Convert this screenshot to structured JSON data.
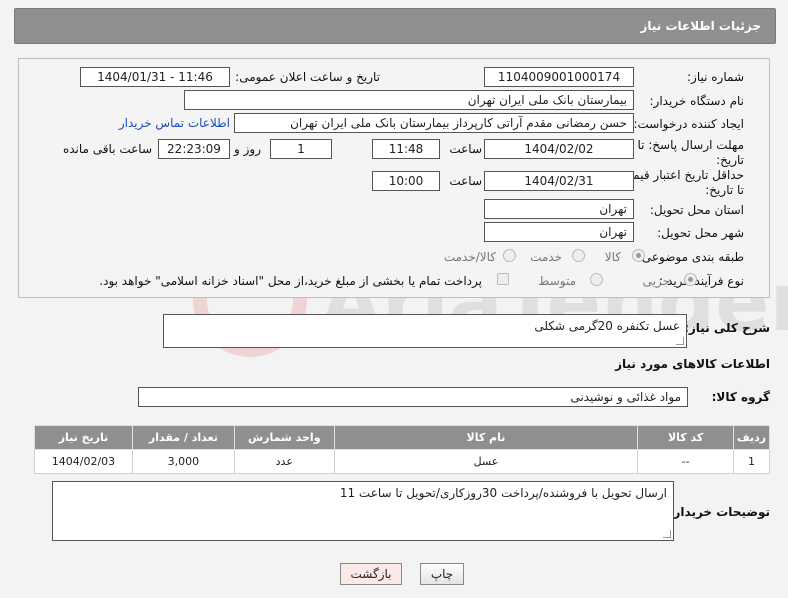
{
  "header": {
    "title": "جزئیات اطلاعات نیاز"
  },
  "form": {
    "need_number_label": "شماره نیاز:",
    "need_number": "1104009001000174",
    "announce_label": "تاریخ و ساعت اعلان عمومی:",
    "announce_value": "1404/01/31 - 11:46",
    "buyer_org_label": "نام دستگاه خریدار:",
    "buyer_org": "بیمارستان بانک ملی ایران تهران",
    "creator_label": "ایجاد کننده درخواست:",
    "creator": "حسن رمضانی مقدم آراتی کارپرداز بیمارستان بانک ملی ایران تهران",
    "contact_link": "اطلاعات تماس خریدار",
    "deadline_label": "مهلت ارسال پاسخ: تا تاریخ:",
    "deadline_date": "1404/02/02",
    "time_label": "ساعت",
    "deadline_time": "11:48",
    "day_label": "روز و",
    "days": "1",
    "remaining": "22:23:09",
    "remaining_label": "ساعت باقی مانده",
    "validity_label": "حداقل تاریخ اعتبار قیمت: تا تاریخ:",
    "validity_date": "1404/02/31",
    "validity_time": "10:00",
    "province_label": "استان محل تحویل:",
    "province": "تهران",
    "city_label": "شهر محل تحویل:",
    "city": "تهران",
    "category_label": "طبقه بندی موضوعی:",
    "category_options": [
      "کالا",
      "خدمت",
      "کالا/خدمت"
    ],
    "process_label": "نوع فرآیند خرید :",
    "process_options": [
      "جزیی",
      "متوسط"
    ],
    "payment_note": "پرداخت تمام یا بخشی از مبلغ خرید،از محل \"اسناد خزانه اسلامی\" خواهد بود."
  },
  "summary": {
    "label": "شرح کلی نیاز:",
    "value": "عسل تکنفره 20گرمی شکلی"
  },
  "goods": {
    "section_title": "اطلاعات کالاهای مورد نیاز",
    "group_label": "گروه کالا:",
    "group_value": "مواد غذائی و نوشیدنی",
    "columns": [
      "ردیف",
      "کد کالا",
      "نام کالا",
      "واحد شمارش",
      "تعداد / مقدار",
      "تاریخ نیاز"
    ],
    "rows": [
      [
        "1",
        "--",
        "عسل",
        "عدد",
        "3,000",
        "1404/02/03"
      ]
    ]
  },
  "notes": {
    "label": "توضیحات خریدار:",
    "value": "ارسال تحویل با فروشنده/پرداخت 30روزکاری/تحویل تا ساعت 11"
  },
  "buttons": {
    "print": "چاپ",
    "back": "بازگشت"
  },
  "colors": {
    "header": "#8f8f8f",
    "link": "#1a4fb8",
    "back_button": "#fde8e8"
  }
}
